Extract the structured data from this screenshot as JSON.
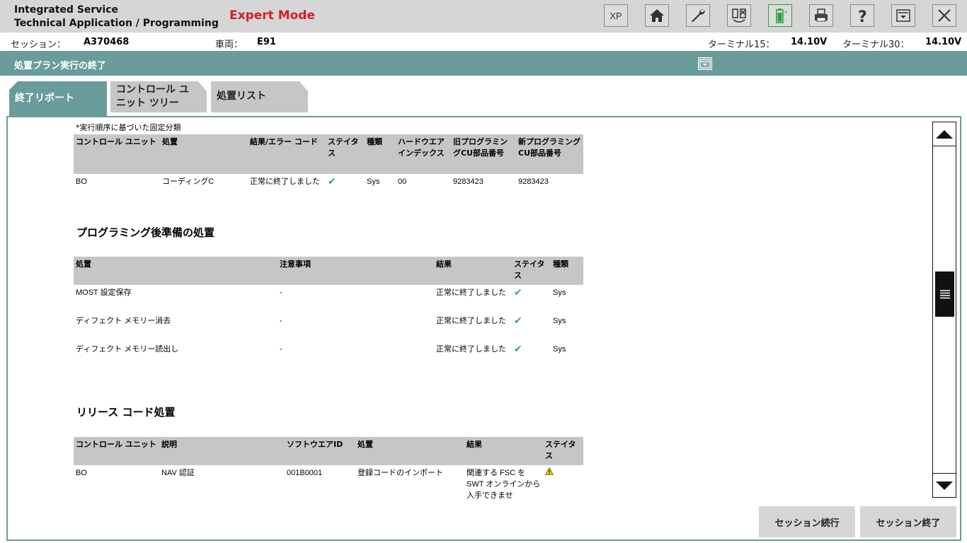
{
  "header": {
    "app_title_line1": "Integrated Service",
    "app_title_line2": "Technical Application / Programming",
    "expert_mode": "Expert Mode",
    "xp_label": "XP"
  },
  "session": {
    "session_label": "セッション：",
    "session_value": "A370468",
    "vehicle_label": "車両：",
    "vehicle_value": "E91",
    "t15_label": "ターミナル15：",
    "t15_value": "14.10V",
    "t30_label": "ターミナル30：",
    "t30_value": "14.10V"
  },
  "page": {
    "title": "処置プラン実行の終了"
  },
  "tabs": [
    {
      "label": "終了リポート",
      "active": true
    },
    {
      "label": "コントロール ユニット ツリー",
      "line1": "コントロール ユ",
      "line2": "ニット ツリー"
    },
    {
      "label": "処置リスト"
    }
  ],
  "note": "*実行順序に基づいた固定分類",
  "table1": {
    "headers": [
      "コントロール ユニット",
      "処置",
      "結果/エラー コード",
      "ステイタス",
      "種類",
      "ハードウエア インデックス",
      "旧プログラミングCU部品番号",
      "新プログラミングCU部品番号"
    ],
    "rows": [
      [
        "BO",
        "コーディングC",
        "正常に終了しました",
        "",
        "Sys",
        "00",
        "9283423",
        "9283423"
      ]
    ]
  },
  "section2_title": "プログラミング後準備の処置",
  "table2": {
    "headers": [
      "処置",
      "注意事項",
      "結果",
      "ステイタス",
      "種類"
    ],
    "rows": [
      [
        "MOST 設定保存",
        "-",
        "正常に終了しました",
        "",
        "Sys"
      ],
      [
        "ディフェクト メモリー消去",
        "-",
        "正常に終了しました",
        "",
        "Sys"
      ],
      [
        "ディフェクト メモリー読出し",
        "-",
        "正常に終了しました",
        "",
        "Sys"
      ]
    ]
  },
  "section3_title": "リリース コード処置",
  "table3": {
    "headers": [
      "コントロール ユニット",
      "説明",
      "ソフトウエアID",
      "処置",
      "結果",
      "ステイタス"
    ],
    "rows": [
      [
        "BO",
        "NAV 認証",
        "001B0001",
        "登録コードのインポート",
        "関連する FSC を SWT オンラインから入手できませ",
        ""
      ]
    ]
  },
  "buttons": {
    "continue": "セッション続行",
    "end": "セッション終了"
  },
  "colors": {
    "teal": "#6a9c9b",
    "header_bg": "#d6d6d6",
    "expert_red": "#d11f2a",
    "check_green": "#3aa852"
  }
}
